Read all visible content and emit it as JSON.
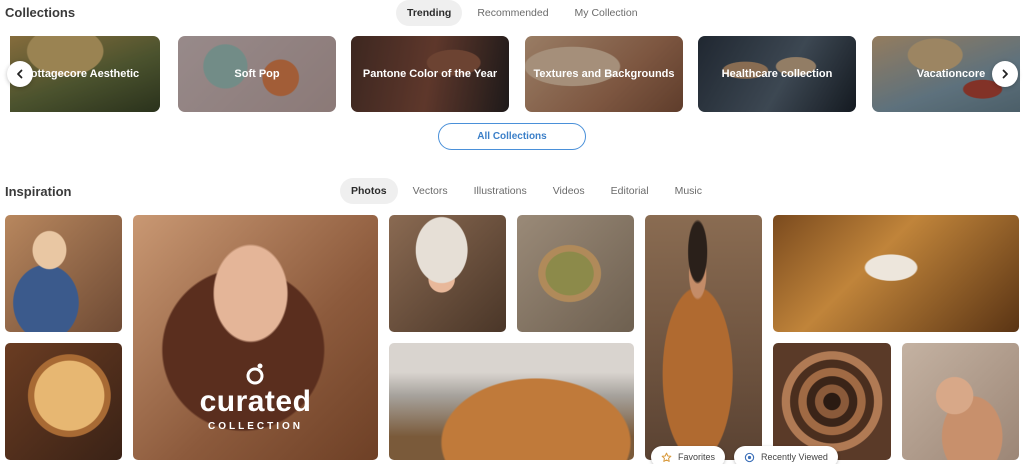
{
  "collections": {
    "title": "Collections",
    "tabs": [
      {
        "label": "Trending",
        "active": true
      },
      {
        "label": "Recommended",
        "active": false
      },
      {
        "label": "My Collection",
        "active": false
      }
    ],
    "cards": [
      {
        "label": "Cottagecore Aesthetic",
        "colors": [
          "#c8a15a",
          "#6f7a44",
          "#3f4a2a"
        ]
      },
      {
        "label": "Soft Pop",
        "colors": [
          "#d9c3c3",
          "#e88a5a",
          "#9cbab5"
        ]
      },
      {
        "label": "Pantone Color of the Year",
        "colors": [
          "#6e4a3a",
          "#9c5a3c",
          "#2c2626"
        ]
      },
      {
        "label": "Textures and Backgrounds",
        "colors": [
          "#e8c2a0",
          "#c08a66",
          "#8c5a40"
        ]
      },
      {
        "label": "Healthcare collection",
        "colors": [
          "#2f3a48",
          "#7a8ea3",
          "#c9b08c"
        ]
      },
      {
        "label": "Vacationcore",
        "colors": [
          "#d9b78c",
          "#8aa7b8",
          "#c04a3a"
        ]
      }
    ],
    "all_button": "All Collections"
  },
  "inspiration": {
    "title": "Inspiration",
    "tabs": [
      {
        "label": "Photos",
        "active": true
      },
      {
        "label": "Vectors",
        "active": false
      },
      {
        "label": "Illustrations",
        "active": false
      },
      {
        "label": "Videos",
        "active": false
      },
      {
        "label": "Editorial",
        "active": false
      },
      {
        "label": "Music",
        "active": false
      }
    ],
    "curated": {
      "word": "curated",
      "sub": "COLLECTION"
    },
    "pills": {
      "favorites": "Favorites",
      "recently_viewed": "Recently Viewed"
    }
  },
  "icons": {
    "prev": "chevron-left-icon",
    "next": "chevron-right-icon",
    "favorites": "star-icon",
    "recent": "eye-icon",
    "logo": "curated-logo-icon"
  },
  "colors": {
    "accent": "#4a90d9",
    "star": "#d99a3c",
    "eye": "#3b6fb8"
  }
}
